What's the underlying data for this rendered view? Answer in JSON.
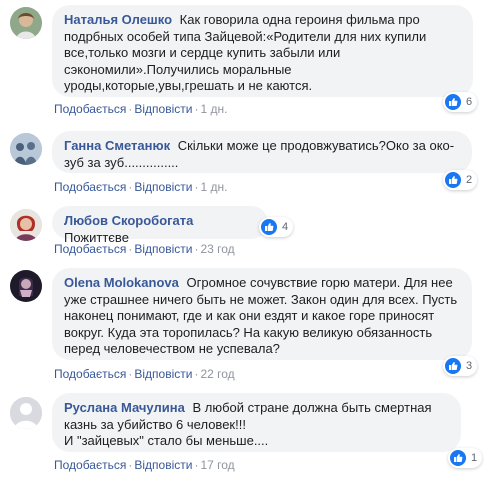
{
  "colors": {
    "author": "#385898",
    "bubble": "#f2f3f5",
    "like": "#1877f2",
    "meta": "#90949c"
  },
  "comments": [
    {
      "author": "Наталья Олешко",
      "text": "Как говорила одна героиня фильма про подрбных особей типа Зайцевой:«Родители для них купили все,только мозги и сердце купить забыли или сэкономили».Получились моральные уроды,которые,увы,грешать и не каются.",
      "like_label": "Подобається",
      "reply_label": "Відповісти",
      "time": "1 дн.",
      "reaction_count": "6"
    },
    {
      "author": "Ганна Сметанюк",
      "text": "Скільки може це продовжуватись?Око за око-зуб за зуб...............",
      "like_label": "Подобається",
      "reply_label": "Відповісти",
      "time": "1 дн.",
      "reaction_count": "2"
    },
    {
      "author": "Любов Скоробогата",
      "text": "Пожиттєве",
      "like_label": "Подобається",
      "reply_label": "Відповісти",
      "time": "23 год",
      "reaction_count": "4"
    },
    {
      "author": "Olena Molokanova",
      "text": "Огромное сочувствие горю матери. Для нее уже страшнее ничего быть не может. Закон один для всех. Пусть наконец понимают, где и как они ездят и какое горе приносят вокруг. Куда эта торопилась? На какую великую обязанность перед человечеством не успевала?",
      "like_label": "Подобається",
      "reply_label": "Відповісти",
      "time": "22 год",
      "reaction_count": "3"
    },
    {
      "author": "Руслана Мачулина",
      "text": "В любой стране должна быть смертная казнь за убийство 6 человек!!!\nИ \"зайцевых\" стало бы меньше....",
      "like_label": "Подобається",
      "reply_label": "Відповісти",
      "time": "17 год",
      "reaction_count": "1"
    }
  ]
}
